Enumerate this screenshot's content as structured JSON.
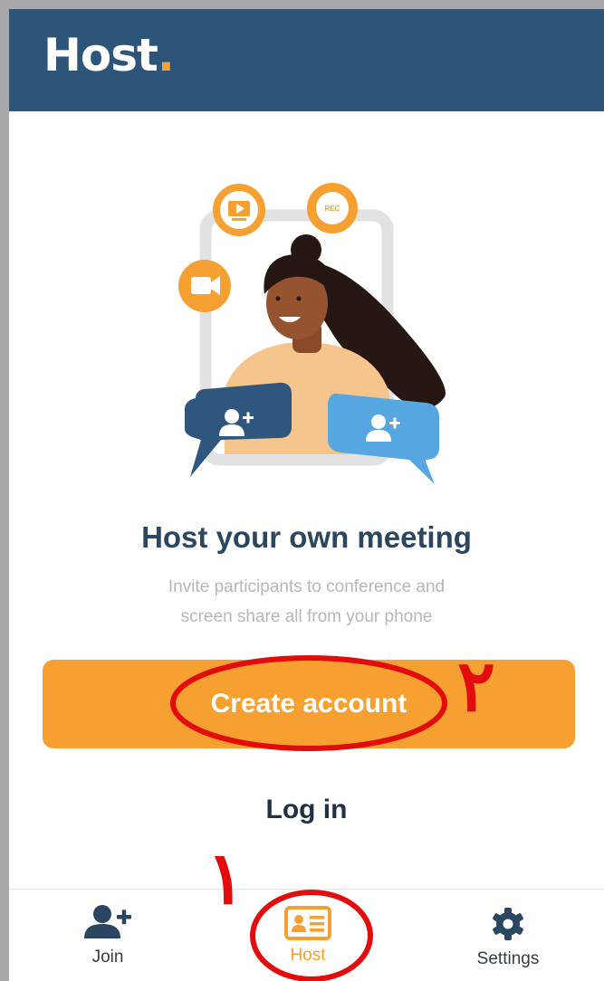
{
  "header": {
    "brand": "Host",
    "brand_dot": "."
  },
  "illustration": {
    "icons": [
      "screen-play-icon",
      "rec-icon",
      "video-camera-icon",
      "add-user-icon",
      "add-user-icon"
    ],
    "rec_label": "REC"
  },
  "main": {
    "title": "Host your own meeting",
    "subtitle_line1": "Invite participants to conference and",
    "subtitle_line2": "screen share all from your phone",
    "create_account": "Create account",
    "log_in": "Log in"
  },
  "nav": {
    "items": [
      {
        "label": "Join",
        "icon": "add-person-icon"
      },
      {
        "label": "Host",
        "icon": "id-card-icon",
        "active": true
      },
      {
        "label": "Settings",
        "icon": "gear-icon"
      }
    ]
  },
  "annotations": {
    "step_one": "١",
    "step_two": "٢"
  },
  "colors": {
    "header_bg": "#2e5479",
    "accent_orange": "#f6a031",
    "title_navy": "#2b4660",
    "bubble_dark": "#2f567d",
    "bubble_light": "#56a6e2",
    "annotation_red": "#e20c0c"
  }
}
